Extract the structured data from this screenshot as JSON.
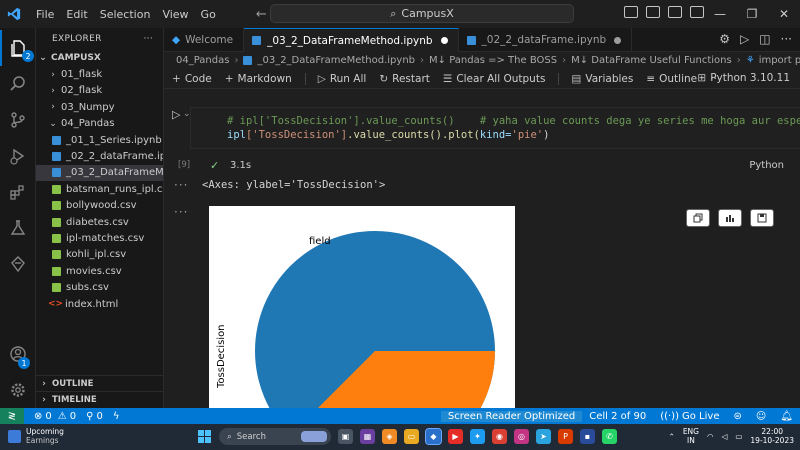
{
  "menu": [
    "File",
    "Edit",
    "Selection",
    "View",
    "Go"
  ],
  "search": {
    "label": "CampusX"
  },
  "activity_badges": {
    "explorer": "2",
    "accounts": "1"
  },
  "sidebar": {
    "title": "EXPLORER",
    "more": "···",
    "root": "CAMPUSX",
    "items": [
      {
        "label": "01_flask",
        "kind": "folder"
      },
      {
        "label": "02_flask",
        "kind": "folder"
      },
      {
        "label": "03_Numpy",
        "kind": "folder"
      },
      {
        "label": "04_Pandas",
        "kind": "folder-open"
      },
      {
        "label": "_01_1_Series.ipynb",
        "kind": "nb"
      },
      {
        "label": "_02_2_dataFrame.ipy...",
        "kind": "nb"
      },
      {
        "label": "_03_2_DataFrameMe...",
        "kind": "nb",
        "selected": true
      },
      {
        "label": "batsman_runs_ipl.csv",
        "kind": "csv"
      },
      {
        "label": "bollywood.csv",
        "kind": "csv"
      },
      {
        "label": "diabetes.csv",
        "kind": "csv"
      },
      {
        "label": "ipl-matches.csv",
        "kind": "csv"
      },
      {
        "label": "kohli_ipl.csv",
        "kind": "csv"
      },
      {
        "label": "movies.csv",
        "kind": "csv"
      },
      {
        "label": "subs.csv",
        "kind": "csv"
      },
      {
        "label": "index.html",
        "kind": "html"
      }
    ],
    "outline": "OUTLINE",
    "timeline": "TIMELINE"
  },
  "tabs": [
    {
      "label": "Welcome",
      "active": false,
      "dirty": false
    },
    {
      "label": "_03_2_DataFrameMethod.ipynb",
      "active": true,
      "dirty": true
    },
    {
      "label": "_02_2_dataFrame.ipynb",
      "active": false,
      "dirty": true
    }
  ],
  "breadcrumb": [
    "04_Pandas",
    "_03_2_DataFrameMethod.ipynb",
    "M↓ Pandas => The BOSS",
    "M↓ DataFrame Useful Functions",
    "import pandas as pd"
  ],
  "toolbar": {
    "code": "Code",
    "markdown": "Markdown",
    "run_all": "Run All",
    "restart": "Restart",
    "clear": "Clear All Outputs",
    "variables": "Variables",
    "outline": "Outline",
    "more": "···",
    "kernel": "Python 3.10.11"
  },
  "cell": {
    "line1_comment": "# ipl['TossDecision'].value_counts()    # yaha value counts dega ye series me hoga aur espe plot k",
    "line2": {
      "var": "ipl",
      "s1": "['TossDecision']",
      "fn1": ".value_counts()",
      "fn2": ".plot(",
      "kw": "kind=",
      "s2": "'pie'",
      "end": ")"
    },
    "exec_count": "[9]",
    "duration": "3.1s",
    "language": "Python"
  },
  "output": {
    "text": "<Axes: ylabel='TossDecision'>",
    "ylabel": "TossDecision",
    "slice_label": "field"
  },
  "colors": {
    "accent": "#0078d4",
    "pie_blue": "#1f77b4",
    "pie_orange": "#ff7f0e"
  },
  "statusbar": {
    "errors": "0",
    "warnings": "0",
    "ports": "0",
    "reader": "Screen Reader Optimized",
    "cell": "Cell 2 of 90",
    "golive": "Go Live"
  },
  "taskbar": {
    "weather_title": "Upcoming",
    "weather_sub": "Earnings",
    "search": "Search",
    "lang": "ENG",
    "region": "IN",
    "time": "22:00",
    "date": "19-10-2023"
  }
}
